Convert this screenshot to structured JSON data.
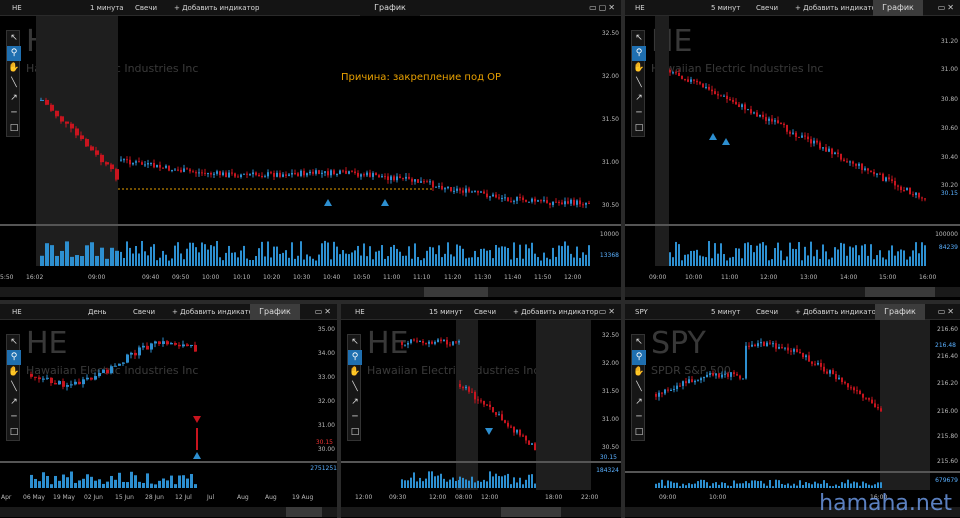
{
  "panels": {
    "p1": {
      "symbol": "HE",
      "interval": "1 минута",
      "chart_type": "Свечи",
      "add_indicator": "+ Добавить индикатор",
      "tab": "График",
      "watermark_symbol": "HE",
      "watermark_name": "Hawaiian Electric Industries Inc",
      "annotation": "Причина: закрепление под ОР",
      "prices": [
        "32.50",
        "32.00",
        "31.50",
        "31.00",
        "30.50"
      ],
      "volume_scale": "10000",
      "volume_value": "13368",
      "times": [
        "5:50",
        "16:02",
        "09:00",
        "09:40",
        "09:50",
        "10:00",
        "10:10",
        "10:20",
        "10:30",
        "10:40",
        "10:50",
        "11:00",
        "11:10",
        "11:20",
        "11:30",
        "11:40",
        "11:50",
        "12:00"
      ]
    },
    "p2": {
      "symbol": "HE",
      "interval": "5 минут",
      "chart_type": "Свечи",
      "add_indicator": "+ Добавить индикатор",
      "tab": "График",
      "watermark_symbol": "HE",
      "watermark_name": "Hawaiian Electric Industries Inc",
      "prices": [
        "31.20",
        "31.00",
        "30.80",
        "30.60",
        "30.40",
        "30.20"
      ],
      "last_price": "30.15",
      "volume_scale": "100000",
      "volume_value": "84239",
      "times": [
        "09:00",
        "10:00",
        "11:00",
        "12:00",
        "13:00",
        "14:00",
        "15:00",
        "16:00"
      ]
    },
    "p3": {
      "symbol": "HE",
      "interval": "День",
      "chart_type": "Свечи",
      "add_indicator": "+ Добавить индикатор",
      "tab": "График",
      "watermark_symbol": "HE",
      "watermark_name": "Hawaiian Electric Industries Inc",
      "prices": [
        "35.00",
        "34.00",
        "33.00",
        "32.00",
        "31.00",
        "30.00"
      ],
      "last_price": "30.15",
      "volume_value": "2751251",
      "times": [
        "Apr",
        "06 May",
        "19 May",
        "02 Jun",
        "15 Jun",
        "28 Jun",
        "12 Jul",
        "Jul",
        "Aug",
        "Aug",
        "19 Aug"
      ]
    },
    "p4": {
      "symbol": "HE",
      "interval": "15 минут",
      "chart_type": "Свечи",
      "add_indicator": "+ Добавить индикатор",
      "tab": "График",
      "watermark_symbol": "HE",
      "watermark_name": "Hawaiian Electric Industries Inc",
      "prices": [
        "32.50",
        "32.00",
        "31.50",
        "31.00",
        "30.50"
      ],
      "last_price": "30.15",
      "volume_value": "184324",
      "times": [
        "12:00",
        "09:30",
        "12:00",
        "08:00",
        "12:00",
        "18:00",
        "22:00"
      ]
    },
    "p5": {
      "symbol": "SPY",
      "interval": "5 минут",
      "chart_type": "Свечи",
      "add_indicator": "+ Добавить индикатор",
      "tab": "График",
      "watermark_symbol": "SPY",
      "watermark_name": "SPDR S&P 500",
      "prices": [
        "216.60",
        "216.40",
        "216.20",
        "216.00",
        "215.80",
        "215.60"
      ],
      "last_price": "216.48",
      "volume_value": "679679",
      "times": [
        "09:00",
        "10:00",
        "16:00"
      ]
    }
  },
  "site_watermark": "hamaha.net",
  "colors": {
    "up": "#2d8fd0",
    "down": "#c8141e",
    "level": "#e8a000",
    "accent": "#1f6fb0"
  }
}
